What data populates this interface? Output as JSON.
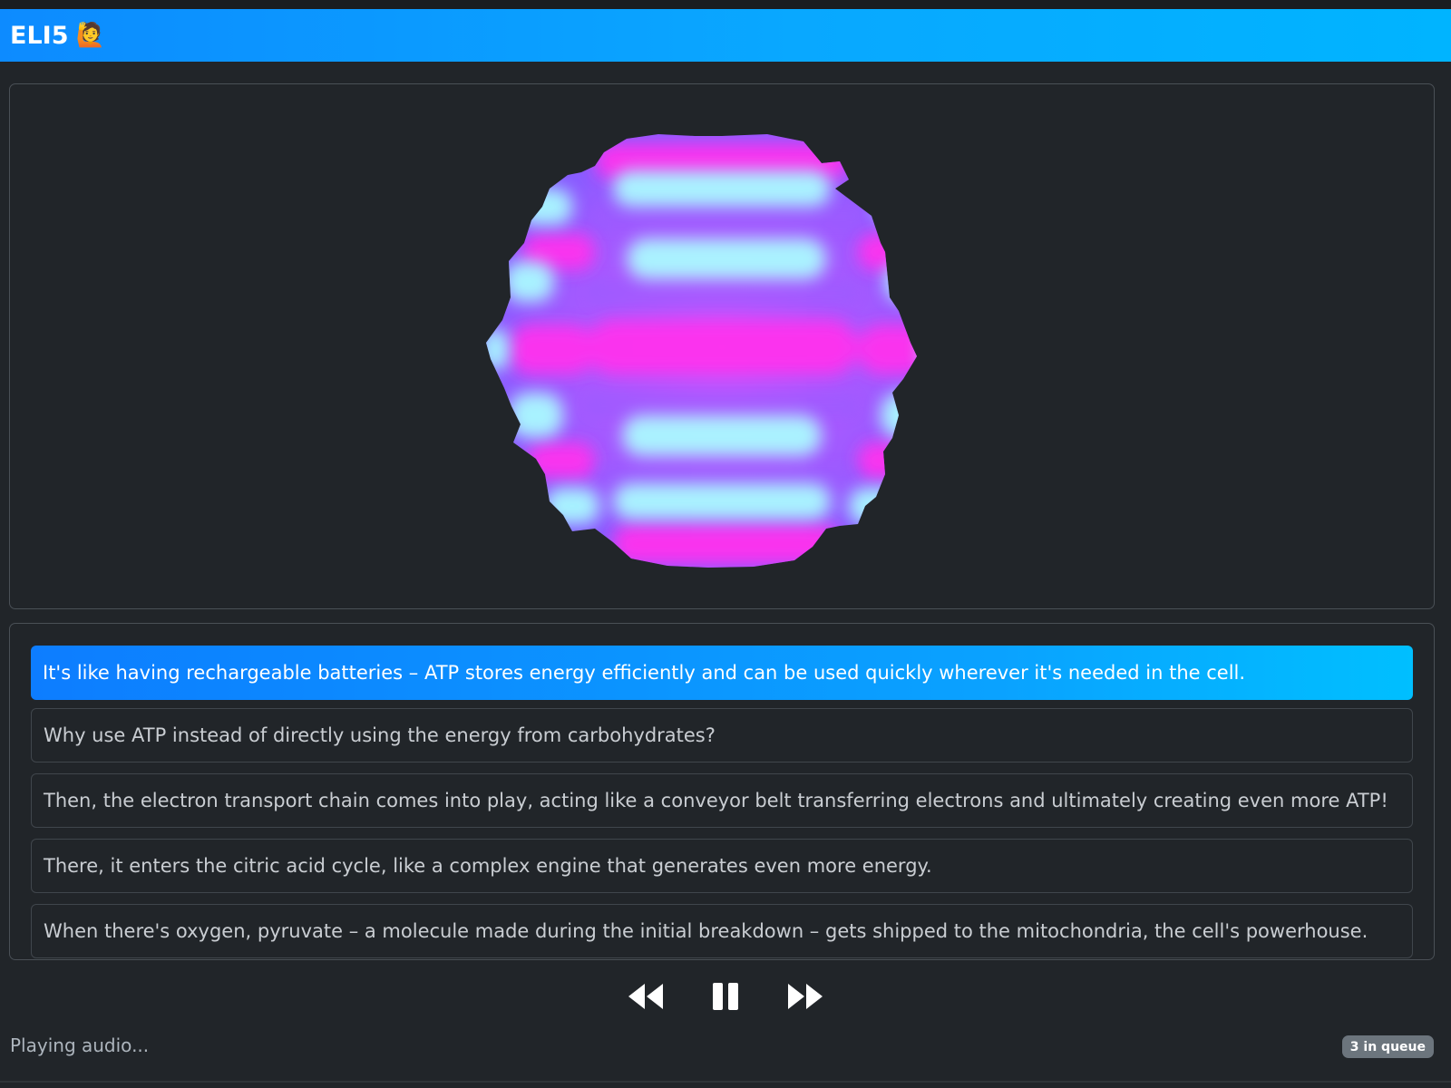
{
  "app": {
    "title": "ELI5",
    "emoji": "🙋"
  },
  "visualizer": {
    "colors": {
      "magenta": "#ff33ee",
      "violet": "#9b5bff",
      "cyan": "#aaffff"
    }
  },
  "messages": [
    {
      "text": "It's like having rechargeable batteries – ATP stores energy efficiently and can be used quickly wherever it's needed in the cell.",
      "active": true
    },
    {
      "text": "Why use ATP instead of directly using the energy from carbohydrates?",
      "active": false
    },
    {
      "text": "Then, the electron transport chain comes into play, acting like a conveyor belt transferring electrons and ultimately creating even more ATP!",
      "active": false
    },
    {
      "text": "There, it enters the citric acid cycle, like a complex engine that generates even more energy.",
      "active": false
    },
    {
      "text": "When there's oxygen, pyruvate – a molecule made during the initial breakdown – gets shipped to the mitochondria, the cell's powerhouse.",
      "active": false
    }
  ],
  "controls": {
    "rewind_icon": "rewind-icon",
    "pause_icon": "pause-icon",
    "forward_icon": "fast-forward-icon"
  },
  "status": {
    "text": "Playing audio...",
    "queue_badge": "3 in queue"
  }
}
